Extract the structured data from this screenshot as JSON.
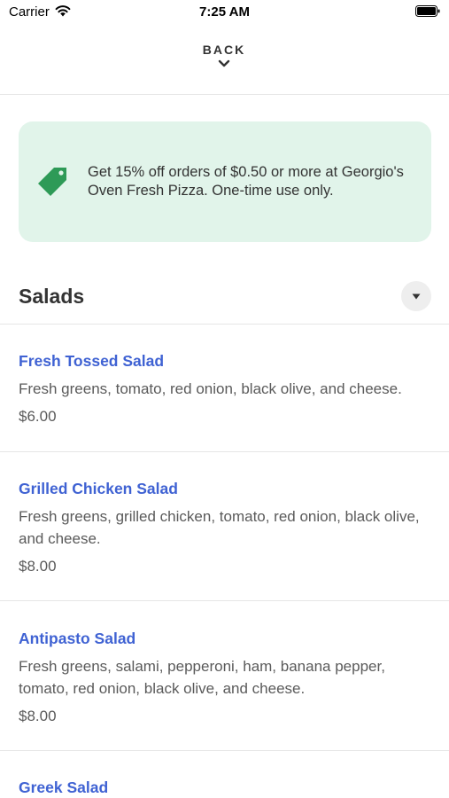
{
  "status_bar": {
    "carrier": "Carrier",
    "time": "7:25 AM"
  },
  "header": {
    "back_label": "BACK"
  },
  "promo": {
    "text": "Get 15% off orders of $0.50 or more at Georgio's Oven Fresh Pizza. One-time use only.",
    "background_color": "#e1f4ea",
    "icon": "tag-icon",
    "icon_color": "#2e9a57"
  },
  "section": {
    "title": "Salads"
  },
  "colors": {
    "link": "#3f62d3",
    "text": "#333333",
    "muted": "#5a5a5a"
  },
  "items": [
    {
      "name": "Fresh Tossed Salad",
      "description": "Fresh greens, tomato, red onion, black olive, and cheese.",
      "price": "$6.00"
    },
    {
      "name": "Grilled Chicken Salad",
      "description": "Fresh greens, grilled chicken, tomato, red onion, black olive, and cheese.",
      "price": "$8.00"
    },
    {
      "name": "Antipasto Salad",
      "description": "Fresh greens, salami, pepperoni, ham, banana pepper, tomato, red onion, black olive, and cheese.",
      "price": "$8.00"
    },
    {
      "name": "Greek Salad"
    }
  ]
}
